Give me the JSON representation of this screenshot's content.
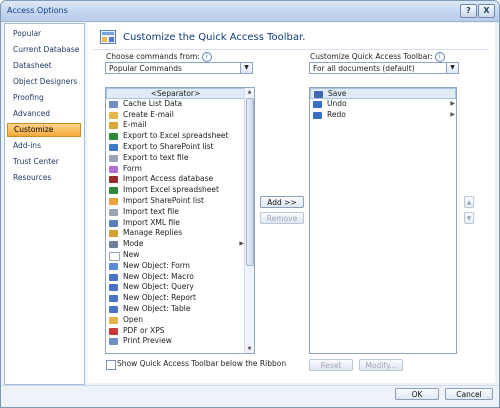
{
  "window": {
    "title": "Access Options",
    "help_glyph": "?",
    "close_glyph": "X"
  },
  "nav": {
    "items": [
      {
        "label": "Popular"
      },
      {
        "label": "Current Database"
      },
      {
        "label": "Datasheet"
      },
      {
        "label": "Object Designers"
      },
      {
        "label": "Proofing"
      },
      {
        "label": "Advanced"
      },
      {
        "label": "Customize",
        "active": true
      },
      {
        "label": "Add-ins"
      },
      {
        "label": "Trust Center"
      },
      {
        "label": "Resources"
      }
    ]
  },
  "header": {
    "title": "Customize the Quick Access Toolbar."
  },
  "choose": {
    "label": "Choose commands from:",
    "value": "Popular Commands"
  },
  "customize": {
    "label": "Customize Quick Access Toolbar:",
    "value": "For all documents (default)"
  },
  "commands": [
    {
      "label": "<Separator>",
      "icon": "separator-icon",
      "color": "#ffffff"
    },
    {
      "label": "Cache List Data",
      "icon": "cache-list-icon",
      "color": "#6f8fc0"
    },
    {
      "label": "Create E-mail",
      "icon": "create-email-icon",
      "color": "#e6b74a"
    },
    {
      "label": "E-mail",
      "icon": "email-icon",
      "color": "#d9a838"
    },
    {
      "label": "Export to Excel spreadsheet",
      "icon": "excel-icon",
      "color": "#2f8a3a"
    },
    {
      "label": "Export to SharePoint list",
      "icon": "sharepoint-icon",
      "color": "#4277c6"
    },
    {
      "label": "Export to text file",
      "icon": "text-file-icon",
      "color": "#9aa5b3"
    },
    {
      "label": "Form",
      "icon": "form-icon",
      "color": "#b06fd1"
    },
    {
      "label": "Import Access database",
      "icon": "access-db-icon",
      "color": "#9c2b2b"
    },
    {
      "label": "Import Excel spreadsheet",
      "icon": "excel-import-icon",
      "color": "#2f8a3a"
    },
    {
      "label": "Import SharePoint list",
      "icon": "sharepoint-import-icon",
      "color": "#e8a33b"
    },
    {
      "label": "Import text file",
      "icon": "text-import-icon",
      "color": "#9aa5b3"
    },
    {
      "label": "Import XML file",
      "icon": "xml-import-icon",
      "color": "#5b7db8"
    },
    {
      "label": "Manage Replies",
      "icon": "manage-replies-icon",
      "color": "#d3a032"
    },
    {
      "label": "Mode",
      "icon": "mode-icon",
      "color": "#6f7f96",
      "submenu": true
    },
    {
      "label": "New",
      "icon": "new-icon",
      "color": "#ffffff"
    },
    {
      "label": "New Object: Form",
      "icon": "new-form-icon",
      "color": "#5c8ad3"
    },
    {
      "label": "New Object: Macro",
      "icon": "new-macro-icon",
      "color": "#4b74c2"
    },
    {
      "label": "New Object: Query",
      "icon": "new-query-icon",
      "color": "#4b74c2"
    },
    {
      "label": "New Object: Report",
      "icon": "new-report-icon",
      "color": "#4b74c2"
    },
    {
      "label": "New Object: Table",
      "icon": "new-table-icon",
      "color": "#4b74c2"
    },
    {
      "label": "Open",
      "icon": "open-folder-icon",
      "color": "#e0b34b"
    },
    {
      "label": "PDF or XPS",
      "icon": "pdf-icon",
      "color": "#c9393b"
    },
    {
      "label": "Print Preview",
      "icon": "print-preview-icon",
      "color": "#6f8fc0"
    }
  ],
  "toolbar_items": [
    {
      "label": "Save",
      "icon": "save-icon",
      "color": "#3f66b1",
      "submenu": false
    },
    {
      "label": "Undo",
      "icon": "undo-icon",
      "color": "#3a6fc4",
      "submenu": true
    },
    {
      "label": "Redo",
      "icon": "redo-icon",
      "color": "#3a6fc4",
      "submenu": true
    }
  ],
  "buttons": {
    "add": "Add >>",
    "remove": "Remove",
    "reset": "Reset",
    "modify": "Modify...",
    "ok": "OK",
    "cancel": "Cancel",
    "move_up": "▲",
    "move_down": "▼"
  },
  "show_below": {
    "label": "Show Quick Access Toolbar below the Ribbon",
    "checked": false
  },
  "colors": {
    "accent": "#f7a93c",
    "title_blue": "#0e3d7a",
    "window_blue": "#c4d6ee"
  }
}
